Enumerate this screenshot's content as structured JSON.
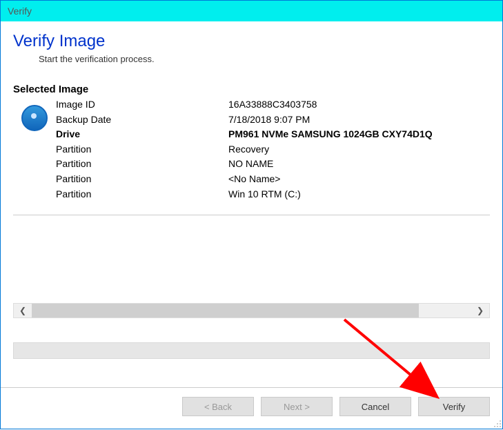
{
  "window": {
    "title": "Verify"
  },
  "header": {
    "title": "Verify Image",
    "subtitle": "Start the verification process."
  },
  "section": {
    "title": "Selected Image"
  },
  "image": {
    "rows": [
      {
        "label": "Image ID",
        "value": "16A33888C3403758",
        "bold": false
      },
      {
        "label": "Backup Date",
        "value": "7/18/2018 9:07 PM",
        "bold": false
      },
      {
        "label": "Drive",
        "value": "PM961 NVMe SAMSUNG 1024GB CXY74D1Q",
        "bold": true
      },
      {
        "label": "Partition",
        "value": "Recovery",
        "bold": false
      },
      {
        "label": "Partition",
        "value": "NO NAME",
        "bold": false
      },
      {
        "label": "Partition",
        "value": "<No Name>",
        "bold": false
      },
      {
        "label": "Partition",
        "value": "Win 10 RTM (C:)",
        "bold": false
      }
    ]
  },
  "buttons": {
    "back": "< Back",
    "next": "Next >",
    "cancel": "Cancel",
    "verify": "Verify"
  }
}
